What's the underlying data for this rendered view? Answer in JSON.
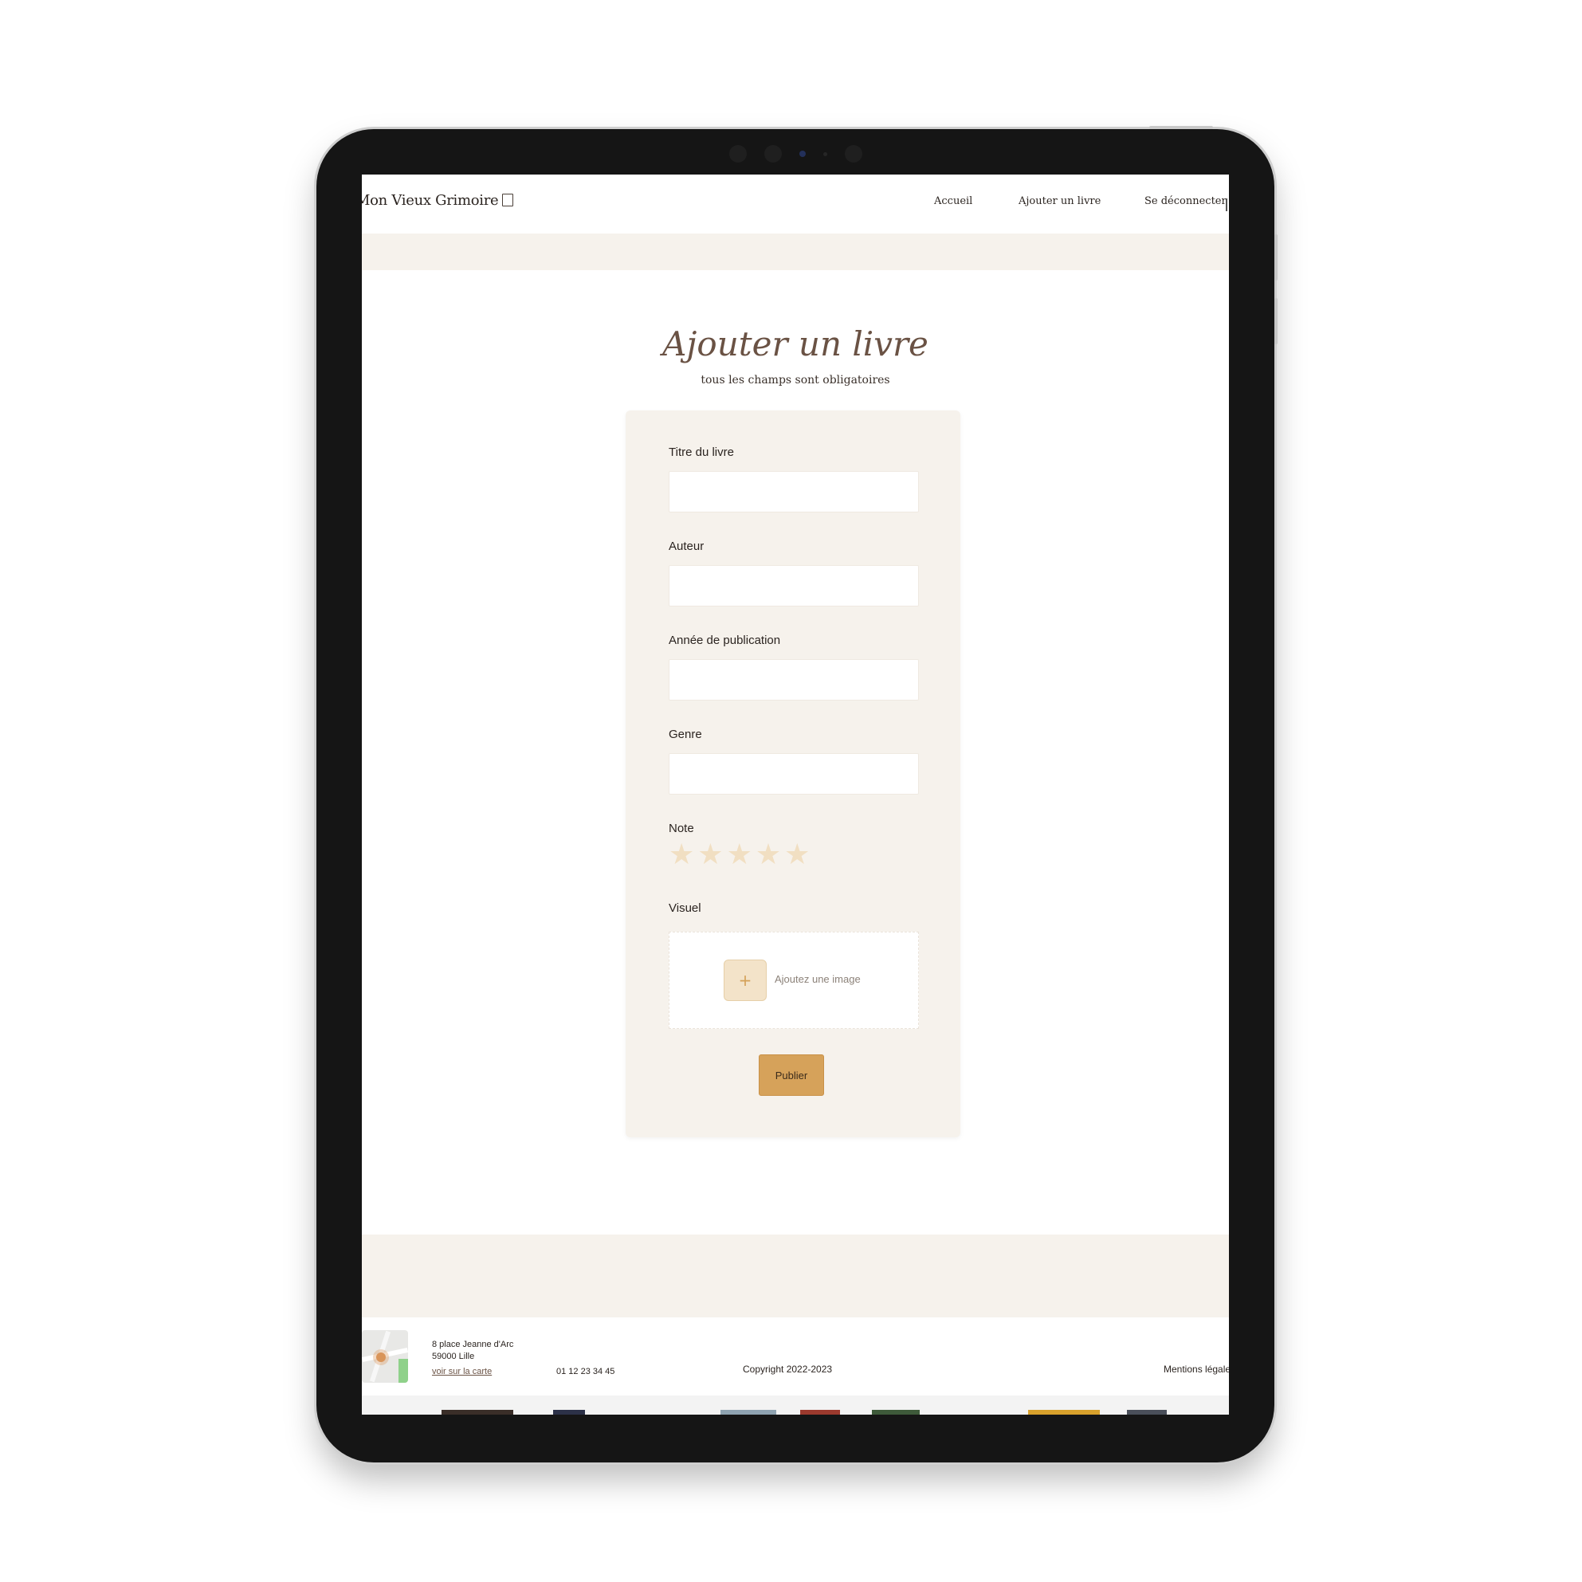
{
  "header": {
    "logo_text": "Mon Vieux Grimoire",
    "nav": {
      "home": "Accueil",
      "add_book": "Ajouter un livre",
      "logout": "Se déconnecter"
    }
  },
  "page": {
    "title": "Ajouter un livre",
    "subtitle": "tous les champs sont obligatoires"
  },
  "form": {
    "fields": [
      {
        "label": "Titre du livre",
        "value": ""
      },
      {
        "label": "Auteur",
        "value": ""
      },
      {
        "label": "Année de publication",
        "value": ""
      },
      {
        "label": "Genre",
        "value": ""
      }
    ],
    "rating": {
      "label": "Note",
      "value": 0,
      "max": 5,
      "star_glyph": "★"
    },
    "visual": {
      "label": "Visuel",
      "add_symbol": "+",
      "add_text": "Ajoutez une image"
    },
    "submit_label": "Publier"
  },
  "footer": {
    "address_line1": "8 place Jeanne d'Arc",
    "address_line2": "59000 Lille",
    "map_link": "voir sur la carte",
    "phone": "01 12 23 34 45",
    "copyright": "Copyright 2022-2023",
    "legal": "Mentions légales"
  },
  "colors": {
    "accent": "#d6a25a",
    "title": "#6a5244",
    "card_bg": "#f6f2ec",
    "star_empty": "#f1dfc2"
  }
}
